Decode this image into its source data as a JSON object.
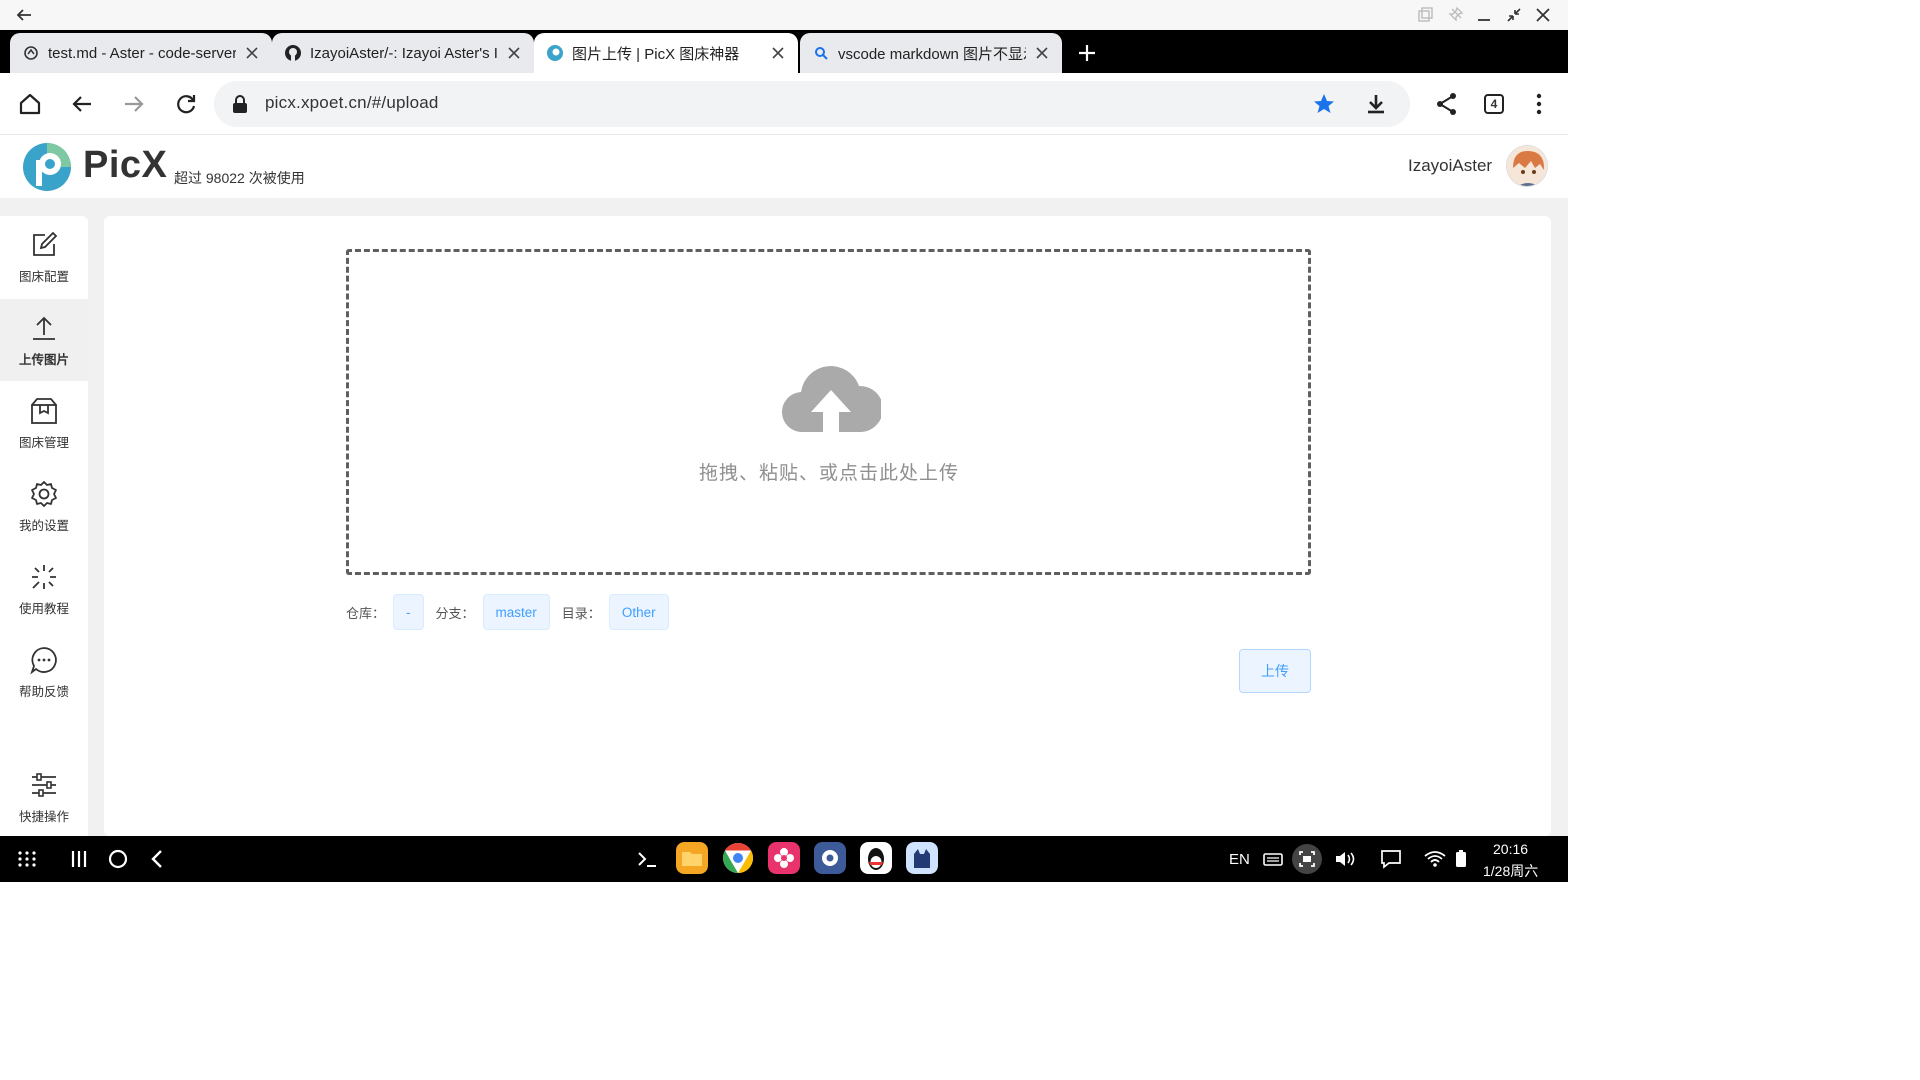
{
  "browser": {
    "tabs": [
      {
        "title": "test.md - Aster - code-server",
        "active": false,
        "icon": "code-server-icon"
      },
      {
        "title": "IzayoiAster/-: Izayoi Aster's In",
        "active": false,
        "icon": "github-icon"
      },
      {
        "title": "图片上传 | PicX 图床神器",
        "active": true,
        "icon": "picx-icon"
      },
      {
        "title": "vscode markdown 图片不显示",
        "active": false,
        "icon": "search-icon"
      }
    ],
    "url": "picx.xpoet.cn/#/upload",
    "tab_count": "4"
  },
  "app": {
    "brand": "PicX",
    "usage": "超过 98022 次被使用",
    "username": "IzayoiAster",
    "accent_color": "#409eff"
  },
  "sidebar": {
    "items": [
      {
        "label": "图床配置",
        "icon": "edit-icon"
      },
      {
        "label": "上传图片",
        "icon": "upload-icon",
        "active": true
      },
      {
        "label": "图床管理",
        "icon": "box-icon"
      },
      {
        "label": "我的设置",
        "icon": "gear-icon"
      },
      {
        "label": "使用教程",
        "icon": "sparkle-icon"
      },
      {
        "label": "帮助反馈",
        "icon": "chat-icon"
      },
      {
        "label": "快捷操作",
        "icon": "sliders-icon"
      }
    ]
  },
  "upload": {
    "hint": "拖拽、粘贴、或点击此处上传",
    "repo_label": "仓库：",
    "repo_value": "-",
    "branch_label": "分支：",
    "branch_value": "master",
    "dir_label": "目录：",
    "dir_value": "Other",
    "upload_button": "上传"
  },
  "taskbar": {
    "lang": "EN",
    "time": "20:16",
    "date": "1/28周六"
  }
}
